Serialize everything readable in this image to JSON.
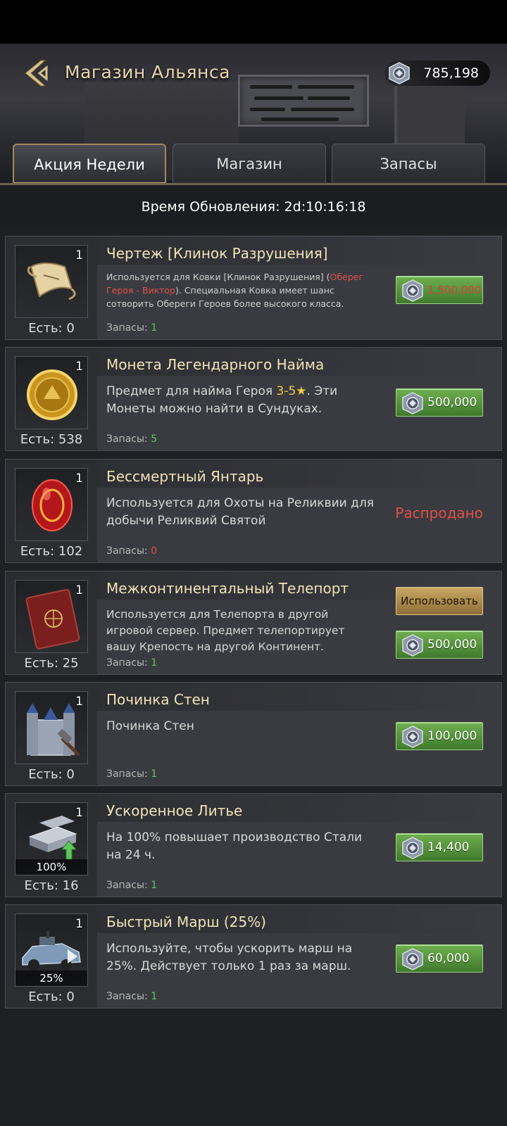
{
  "header": {
    "title": "Магазин Альянса",
    "currency_value": "785,198",
    "currency_icon": "alliance-coin-icon",
    "back_icon": "back-chevron-icon"
  },
  "tabs": [
    {
      "label": "Акция Недели",
      "active": true
    },
    {
      "label": "Магазин",
      "active": false
    },
    {
      "label": "Запасы",
      "active": false
    }
  ],
  "timer": {
    "label": "Время Обновления: 2d:10:16:18"
  },
  "stock_prefix": "Запасы: ",
  "items": [
    {
      "qty": "1",
      "own": "Есть: 0",
      "name": "Чертеж [Клинок Разрушения]",
      "desc_a": "Используется для Ковки [Клинок Разрушения] (",
      "desc_hl": "Оберег Героя - Виктор",
      "desc_b": "). Специальная Ковка имеет шанс сотворить Обереги Героев более высокого класса.",
      "stock": "1",
      "price": "1,500,000",
      "icon": "blueprint-scroll-icon"
    },
    {
      "qty": "1",
      "own": "Есть: 538",
      "name": "Монета Легендарного Найма",
      "desc_a": "Предмет для найма Героя ",
      "desc_hl": "3-5★",
      "desc_b": ". Эти Монеты можно найти в Сундуках.",
      "stock": "5",
      "price": "500,000",
      "icon": "gold-coin-icon"
    },
    {
      "qty": "1",
      "own": "Есть: 102",
      "name": "Бессмертный Янтарь",
      "desc": "Используется для Охоты на Реликвии для добычи Реликвий Святой",
      "stock": "0",
      "soldout": "Распродано",
      "icon": "red-amber-icon"
    },
    {
      "qty": "1",
      "own": "Есть: 25",
      "name": "Межконтинентальный Телепорт",
      "desc": "Используется для Телепорта в другой игровой сервер. Предмет телепортирует вашу Крепость на другой Континент.",
      "stock": "1",
      "use_label": "Использовать",
      "price": "500,000",
      "icon": "passport-icon"
    },
    {
      "qty": "1",
      "own": "Есть: 0",
      "name": "Починка Стен",
      "desc": "Починка Стен",
      "stock": "1",
      "price": "100,000",
      "icon": "castle-repair-icon"
    },
    {
      "qty": "1",
      "own": "Есть: 16",
      "name": "Ускоренное Литье",
      "desc": "На 100% повышает производство Стали на 24 ч.",
      "stock": "1",
      "pct": "100%",
      "price": "14,400",
      "icon": "steel-boost-icon"
    },
    {
      "qty": "1",
      "own": "Есть: 0",
      "name": "Быстрый Марш (25%)",
      "desc": "Используйте, чтобы ускорить марш на 25%. Действует только 1 раз за марш.",
      "stock": "1",
      "pct": "25%",
      "price": "60,000",
      "icon": "armored-car-icon"
    }
  ],
  "colors": {
    "accent_gold": "#c9a870",
    "buy_green": "#4f8c36",
    "stock_green": "#5cc85c",
    "sold_red": "#e0504a"
  }
}
